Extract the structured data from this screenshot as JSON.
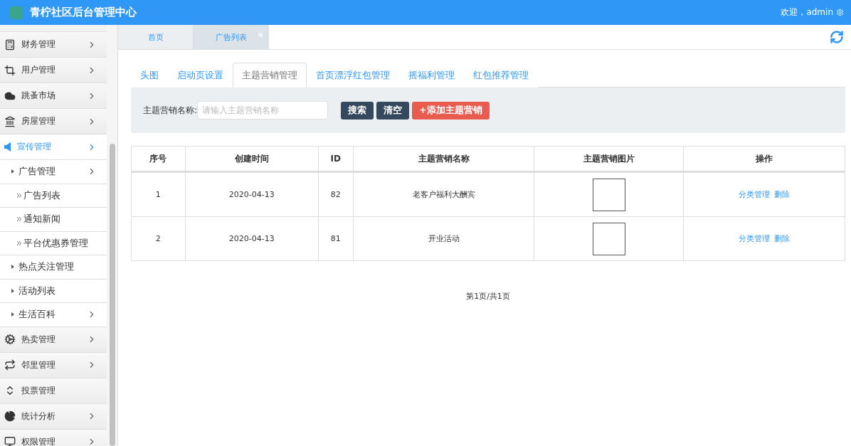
{
  "header": {
    "title": "青柠社区后台管理中心",
    "welcome": "欢迎，admin"
  },
  "sidebar": {
    "items": [
      {
        "label": "财务管理",
        "kind": "calculator",
        "selected": false,
        "has_submenu": true
      },
      {
        "label": "用户管理",
        "kind": "crop",
        "selected": false,
        "has_submenu": true
      },
      {
        "label": "跳蚤市场",
        "kind": "cloud",
        "selected": false,
        "has_submenu": true
      },
      {
        "label": "房屋管理",
        "kind": "bank",
        "selected": false,
        "has_submenu": true
      },
      {
        "label": "宣传管理",
        "kind": "speaker",
        "selected": true,
        "has_submenu": true,
        "children": [
          {
            "label": "广告管理",
            "has_submenu": true,
            "children": [
              {
                "label": "广告列表"
              },
              {
                "label": "通知新闻"
              },
              {
                "label": "平台优惠券管理"
              }
            ]
          },
          {
            "label": "热点关注管理",
            "has_submenu": false
          },
          {
            "label": "活动列表",
            "has_submenu": false
          },
          {
            "label": "生活百科",
            "has_submenu": true
          }
        ]
      },
      {
        "label": "热卖管理",
        "kind": "gear",
        "selected": false,
        "has_submenu": true
      },
      {
        "label": "邻里管理",
        "kind": "repeat",
        "selected": false,
        "has_submenu": true
      },
      {
        "label": "投票管理",
        "kind": "sort",
        "selected": false,
        "has_submenu": false
      },
      {
        "label": "统计分析",
        "kind": "pie",
        "selected": false,
        "has_submenu": true
      },
      {
        "label": "权限管理",
        "kind": "monitor",
        "selected": false,
        "has_submenu": true
      }
    ]
  },
  "page_tabs": [
    {
      "label": "首页",
      "selected": false,
      "closable": false
    },
    {
      "label": "广告列表",
      "selected": true,
      "closable": true
    }
  ],
  "sub_tabs": [
    {
      "label": "头图",
      "selected": false
    },
    {
      "label": "启动页设置",
      "selected": false
    },
    {
      "label": "主题营销管理",
      "selected": true
    },
    {
      "label": "首页漂浮红包管理",
      "selected": false
    },
    {
      "label": "摇福利管理",
      "selected": false
    },
    {
      "label": "红包推荐管理",
      "selected": false
    }
  ],
  "search": {
    "label": "主题营销名称:",
    "placeholder": "请输入主题营销名称",
    "buttons": [
      {
        "label": "搜索",
        "kind": "dark"
      },
      {
        "label": "清空",
        "kind": "dark"
      },
      {
        "label": "+添加主题营销",
        "kind": "danger"
      }
    ]
  },
  "table": {
    "columns": [
      "序号",
      "创建时间",
      "ID",
      "主题营销名称",
      "主题营销图片",
      "操作"
    ],
    "rows": [
      {
        "index": "1",
        "created": "2020-04-13",
        "id": "82",
        "name": "老客户福利大酬宾",
        "actions": [
          "分类管理",
          "删除"
        ]
      },
      {
        "index": "2",
        "created": "2020-04-13",
        "id": "81",
        "name": "开业活动",
        "actions": [
          "分类管理",
          "删除"
        ]
      }
    ]
  },
  "pagination": "第1页/共1页"
}
